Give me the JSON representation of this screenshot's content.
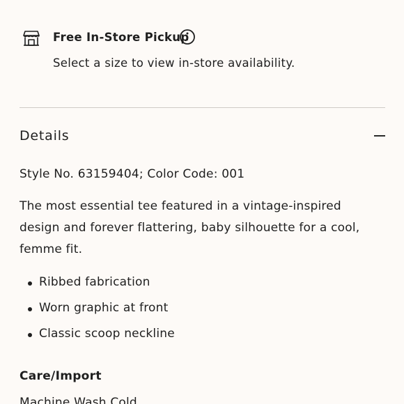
{
  "pickup": {
    "title": "Free In-Store Pickup",
    "subtitle": "Select a size to view in-store availability.",
    "icon": "store-icon",
    "info_icon": "info-icon"
  },
  "details": {
    "title": "Details",
    "toggle_icon": "minus-icon",
    "style_line": "Style No. 63159404; Color Code: 001",
    "description": "The most essential tee featured in a vintage-inspired design and forever flattering, baby silhouette for a cool, femme fit.",
    "bullets": [
      "Ribbed fabrication",
      "Worn graphic at front",
      "Classic scoop neckline"
    ]
  },
  "care": {
    "title": "Care/Import",
    "first_line": "Machine Wash Cold"
  }
}
